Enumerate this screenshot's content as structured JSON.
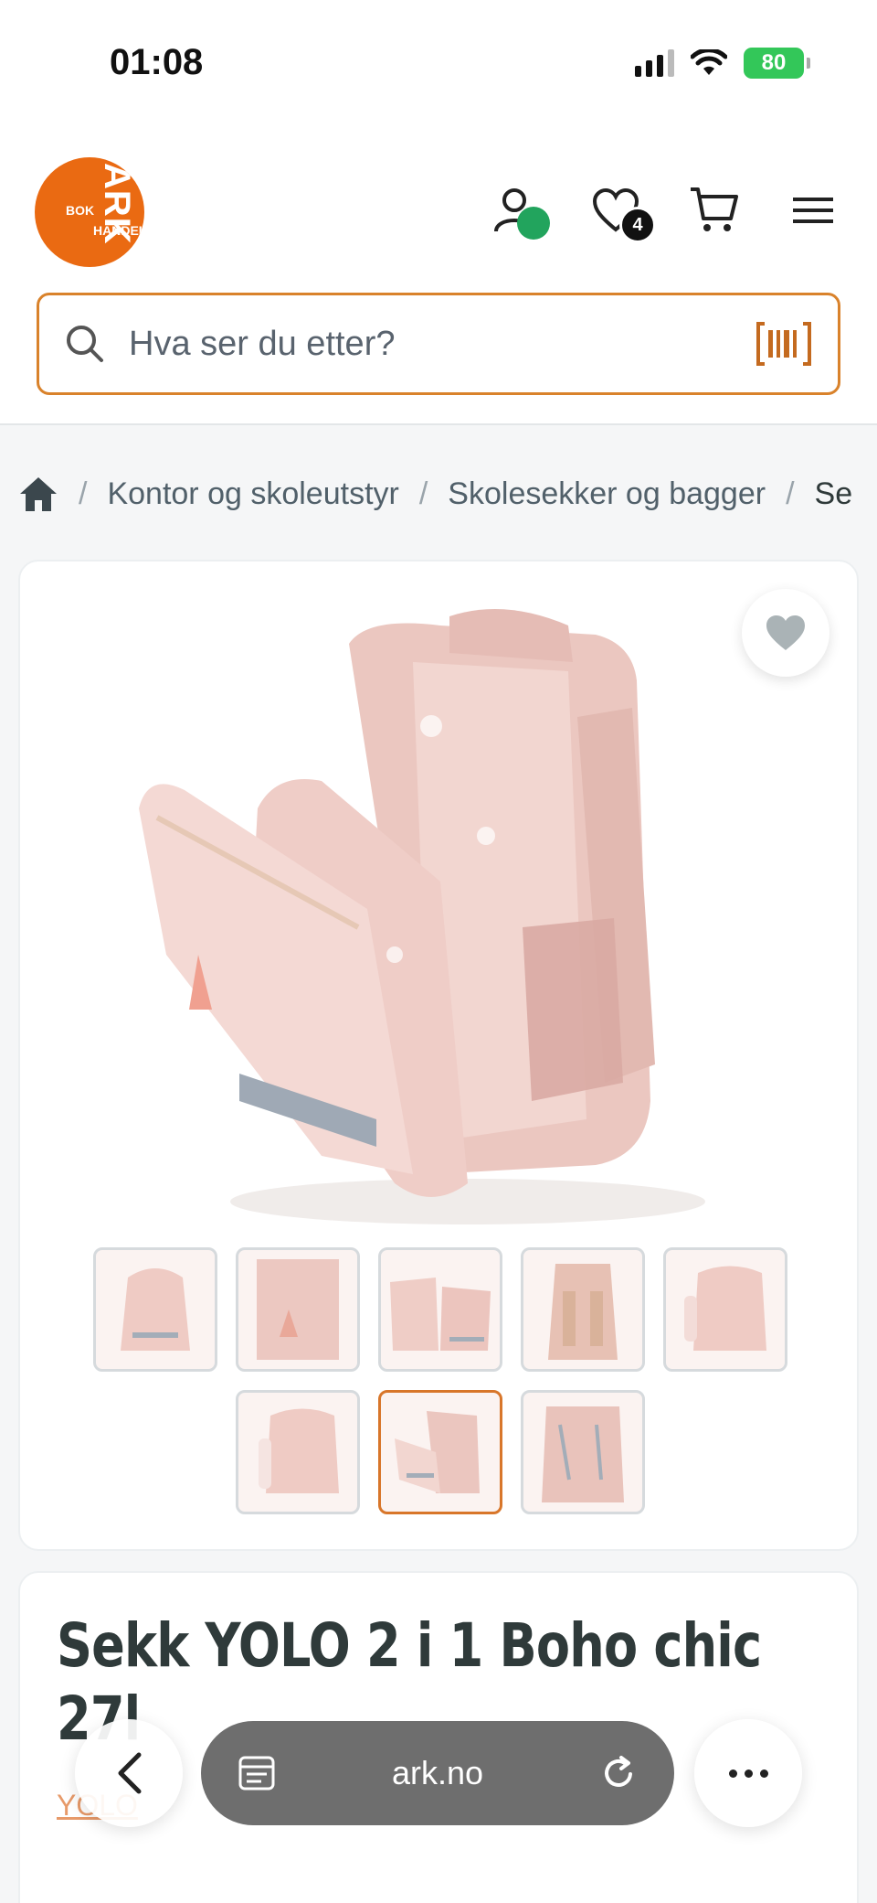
{
  "status_bar": {
    "time": "01:08",
    "battery": "80"
  },
  "header": {
    "logo": {
      "big": "ARK",
      "small1": "BOK",
      "small2": "HANDEL"
    },
    "wishlist_count": "4",
    "search": {
      "placeholder": "Hva ser du etter?"
    }
  },
  "breadcrumb": {
    "items": [
      "Kontor og skoleutstyr",
      "Skolesekker og bagger",
      "Se"
    ]
  },
  "gallery": {
    "thumbnail_count": 8,
    "active_thumbnail": 7
  },
  "product": {
    "title": "Sekk YOLO 2 i 1 Boho chic 27l",
    "brand": "YOLO"
  },
  "browser": {
    "url": "ark.no"
  },
  "colors": {
    "accent": "#ea6a12",
    "search_border": "#d9822b",
    "online_dot": "#22a45d",
    "battery": "#33c759"
  }
}
